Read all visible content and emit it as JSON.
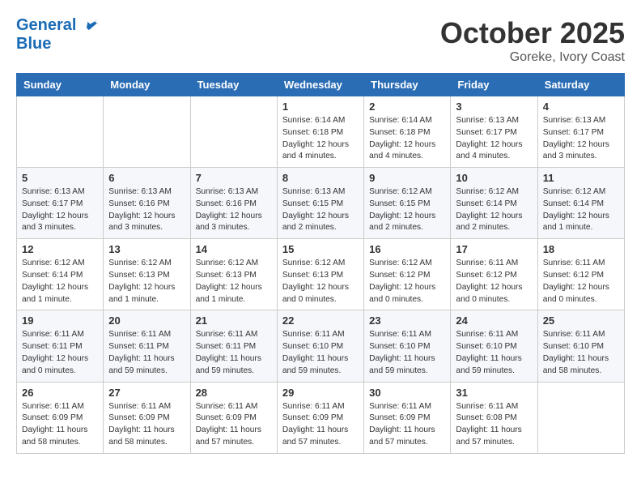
{
  "header": {
    "logo_line1": "General",
    "logo_line2": "Blue",
    "month": "October 2025",
    "location": "Goreke, Ivory Coast"
  },
  "weekdays": [
    "Sunday",
    "Monday",
    "Tuesday",
    "Wednesday",
    "Thursday",
    "Friday",
    "Saturday"
  ],
  "weeks": [
    [
      {
        "day": "",
        "info": ""
      },
      {
        "day": "",
        "info": ""
      },
      {
        "day": "",
        "info": ""
      },
      {
        "day": "1",
        "info": "Sunrise: 6:14 AM\nSunset: 6:18 PM\nDaylight: 12 hours and 4 minutes."
      },
      {
        "day": "2",
        "info": "Sunrise: 6:14 AM\nSunset: 6:18 PM\nDaylight: 12 hours and 4 minutes."
      },
      {
        "day": "3",
        "info": "Sunrise: 6:13 AM\nSunset: 6:17 PM\nDaylight: 12 hours and 4 minutes."
      },
      {
        "day": "4",
        "info": "Sunrise: 6:13 AM\nSunset: 6:17 PM\nDaylight: 12 hours and 3 minutes."
      }
    ],
    [
      {
        "day": "5",
        "info": "Sunrise: 6:13 AM\nSunset: 6:17 PM\nDaylight: 12 hours and 3 minutes."
      },
      {
        "day": "6",
        "info": "Sunrise: 6:13 AM\nSunset: 6:16 PM\nDaylight: 12 hours and 3 minutes."
      },
      {
        "day": "7",
        "info": "Sunrise: 6:13 AM\nSunset: 6:16 PM\nDaylight: 12 hours and 3 minutes."
      },
      {
        "day": "8",
        "info": "Sunrise: 6:13 AM\nSunset: 6:15 PM\nDaylight: 12 hours and 2 minutes."
      },
      {
        "day": "9",
        "info": "Sunrise: 6:12 AM\nSunset: 6:15 PM\nDaylight: 12 hours and 2 minutes."
      },
      {
        "day": "10",
        "info": "Sunrise: 6:12 AM\nSunset: 6:14 PM\nDaylight: 12 hours and 2 minutes."
      },
      {
        "day": "11",
        "info": "Sunrise: 6:12 AM\nSunset: 6:14 PM\nDaylight: 12 hours and 1 minute."
      }
    ],
    [
      {
        "day": "12",
        "info": "Sunrise: 6:12 AM\nSunset: 6:14 PM\nDaylight: 12 hours and 1 minute."
      },
      {
        "day": "13",
        "info": "Sunrise: 6:12 AM\nSunset: 6:13 PM\nDaylight: 12 hours and 1 minute."
      },
      {
        "day": "14",
        "info": "Sunrise: 6:12 AM\nSunset: 6:13 PM\nDaylight: 12 hours and 1 minute."
      },
      {
        "day": "15",
        "info": "Sunrise: 6:12 AM\nSunset: 6:13 PM\nDaylight: 12 hours and 0 minutes."
      },
      {
        "day": "16",
        "info": "Sunrise: 6:12 AM\nSunset: 6:12 PM\nDaylight: 12 hours and 0 minutes."
      },
      {
        "day": "17",
        "info": "Sunrise: 6:11 AM\nSunset: 6:12 PM\nDaylight: 12 hours and 0 minutes."
      },
      {
        "day": "18",
        "info": "Sunrise: 6:11 AM\nSunset: 6:12 PM\nDaylight: 12 hours and 0 minutes."
      }
    ],
    [
      {
        "day": "19",
        "info": "Sunrise: 6:11 AM\nSunset: 6:11 PM\nDaylight: 12 hours and 0 minutes."
      },
      {
        "day": "20",
        "info": "Sunrise: 6:11 AM\nSunset: 6:11 PM\nDaylight: 11 hours and 59 minutes."
      },
      {
        "day": "21",
        "info": "Sunrise: 6:11 AM\nSunset: 6:11 PM\nDaylight: 11 hours and 59 minutes."
      },
      {
        "day": "22",
        "info": "Sunrise: 6:11 AM\nSunset: 6:10 PM\nDaylight: 11 hours and 59 minutes."
      },
      {
        "day": "23",
        "info": "Sunrise: 6:11 AM\nSunset: 6:10 PM\nDaylight: 11 hours and 59 minutes."
      },
      {
        "day": "24",
        "info": "Sunrise: 6:11 AM\nSunset: 6:10 PM\nDaylight: 11 hours and 59 minutes."
      },
      {
        "day": "25",
        "info": "Sunrise: 6:11 AM\nSunset: 6:10 PM\nDaylight: 11 hours and 58 minutes."
      }
    ],
    [
      {
        "day": "26",
        "info": "Sunrise: 6:11 AM\nSunset: 6:09 PM\nDaylight: 11 hours and 58 minutes."
      },
      {
        "day": "27",
        "info": "Sunrise: 6:11 AM\nSunset: 6:09 PM\nDaylight: 11 hours and 58 minutes."
      },
      {
        "day": "28",
        "info": "Sunrise: 6:11 AM\nSunset: 6:09 PM\nDaylight: 11 hours and 57 minutes."
      },
      {
        "day": "29",
        "info": "Sunrise: 6:11 AM\nSunset: 6:09 PM\nDaylight: 11 hours and 57 minutes."
      },
      {
        "day": "30",
        "info": "Sunrise: 6:11 AM\nSunset: 6:09 PM\nDaylight: 11 hours and 57 minutes."
      },
      {
        "day": "31",
        "info": "Sunrise: 6:11 AM\nSunset: 6:08 PM\nDaylight: 11 hours and 57 minutes."
      },
      {
        "day": "",
        "info": ""
      }
    ]
  ]
}
